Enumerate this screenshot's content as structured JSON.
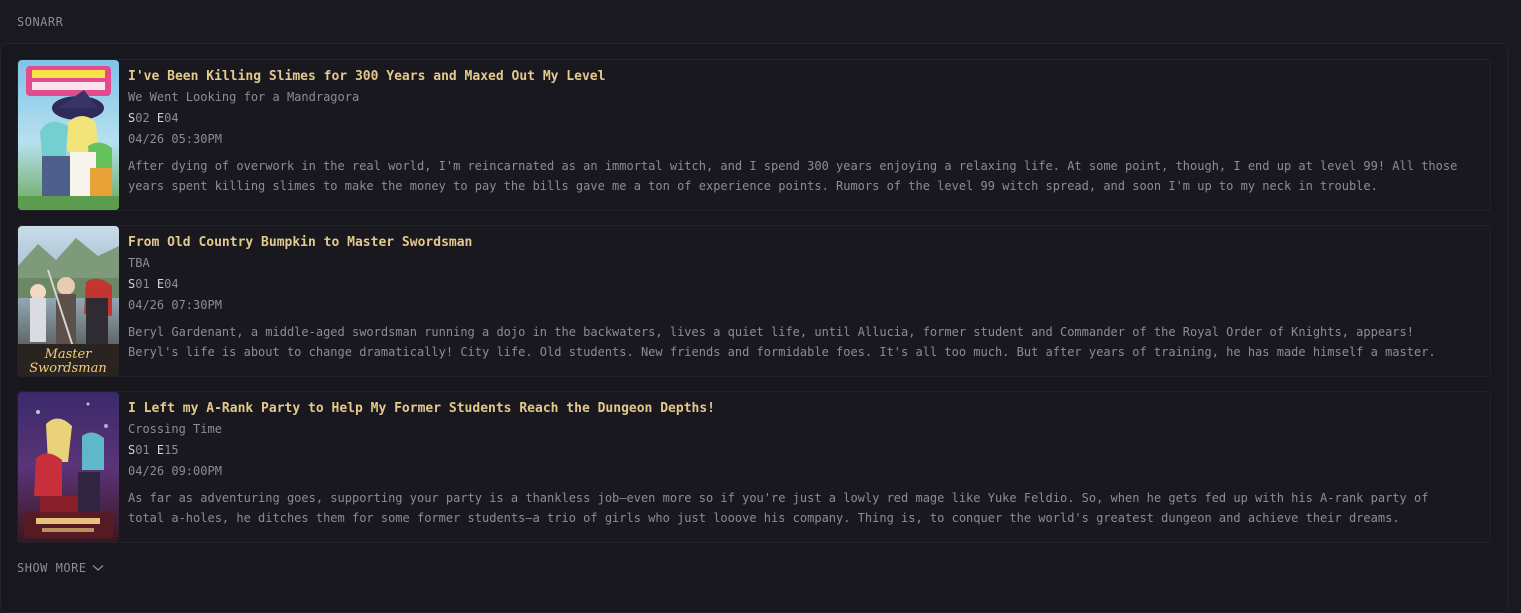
{
  "widget": {
    "title": "SONARR",
    "show_more_label": "SHOW MORE"
  },
  "episodes": [
    {
      "title": "I've Been Killing Slimes for 300 Years and Maxed Out My Level",
      "episode_title": "We Went Looking for a Mandragora",
      "season_prefix": "S",
      "season": "02",
      "episode_prefix": "E",
      "episode": "04",
      "air_date": "04/26 05:30PM",
      "overview": "After dying of overwork in the real world, I'm reincarnated as an immortal witch, and I spend 300 years enjoying a relaxing life. At some point, though, I end up at level 99! All those years spent killing slimes to make the money to pay the bills gave me a ton of experience points. Rumors of the level 99 witch spread, and soon I'm up to my neck in trouble.",
      "poster_icon": "anime-poster-slimes"
    },
    {
      "title": "From Old Country Bumpkin to Master Swordsman",
      "episode_title": "TBA",
      "season_prefix": "S",
      "season": "01",
      "episode_prefix": "E",
      "episode": "04",
      "air_date": "04/26 07:30PM",
      "overview": "Beryl Gardenant, a middle-aged swordsman running a dojo in the backwaters, lives a quiet life, until Allucia, former student and Commander of the Royal Order of Knights, appears! Beryl's life is about to change dramatically! City life. Old students. New friends and formidable foes. It's all too much. But after years of training, he has made himself a master.",
      "poster_icon": "anime-poster-swordsman"
    },
    {
      "title": "I Left my A-Rank Party to Help My Former Students Reach the Dungeon Depths!",
      "episode_title": "Crossing Time",
      "season_prefix": "S",
      "season": "01",
      "episode_prefix": "E",
      "episode": "15",
      "air_date": "04/26 09:00PM",
      "overview": "As far as adventuring goes, supporting your party is a thankless job—even more so if you're just a lowly red mage like Yuke Feldio. So, when he gets fed up with his A-rank party of total a-holes, he ditches them for some former students—a trio of girls who just looove his company. Thing is, to conquer the world's greatest dungeon and achieve their dreams.",
      "poster_icon": "anime-poster-dungeon"
    }
  ],
  "colors": {
    "background": "#1a191f",
    "title": "#e3c98c",
    "muted_text": "#8d8b95",
    "card_border": "#232229"
  }
}
